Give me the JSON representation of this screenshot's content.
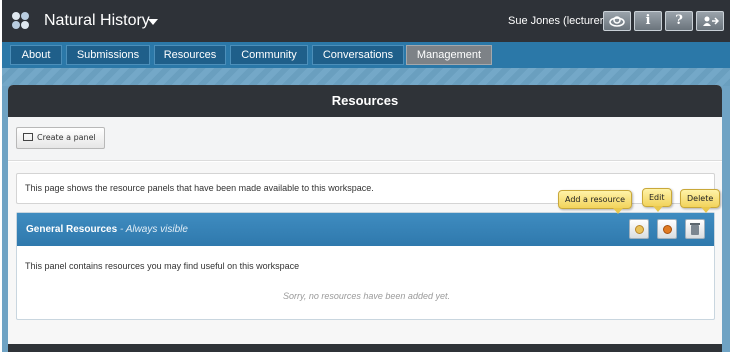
{
  "header": {
    "workspace_title": "Natural History",
    "user_label": "Sue Jones (lecturer)",
    "buttons": [
      {
        "name": "profile-button",
        "icon": "cloud-icon",
        "label": ""
      },
      {
        "name": "info-button",
        "icon": "info-icon",
        "label": "i"
      },
      {
        "name": "help-button",
        "icon": "help-icon",
        "label": "?"
      },
      {
        "name": "logout-button",
        "icon": "logout-icon",
        "label": ""
      }
    ]
  },
  "nav": {
    "tabs": [
      {
        "label": "About",
        "active": false
      },
      {
        "label": "Submissions",
        "active": false
      },
      {
        "label": "Resources",
        "active": false
      },
      {
        "label": "Community",
        "active": false
      },
      {
        "label": "Conversations",
        "active": false
      },
      {
        "label": "Management",
        "active": true
      }
    ]
  },
  "page": {
    "title": "Resources",
    "create_panel_label": "Create a panel",
    "info_text": "This page shows the resource panels that have been made available to this workspace."
  },
  "panel": {
    "title": "General Resources",
    "visibility": "- Always visible",
    "description": "This panel contains resources you may find useful on this workspace",
    "empty_note": "Sorry, no resources have been added yet.",
    "tooltips": {
      "add": "Add a resource",
      "edit": "Edit",
      "delete": "Delete"
    }
  },
  "colors": {
    "accent": "#2b78a8",
    "header_dark": "#2e3238",
    "active_tab": "#7d8287",
    "tooltip": "#f2d35c"
  }
}
